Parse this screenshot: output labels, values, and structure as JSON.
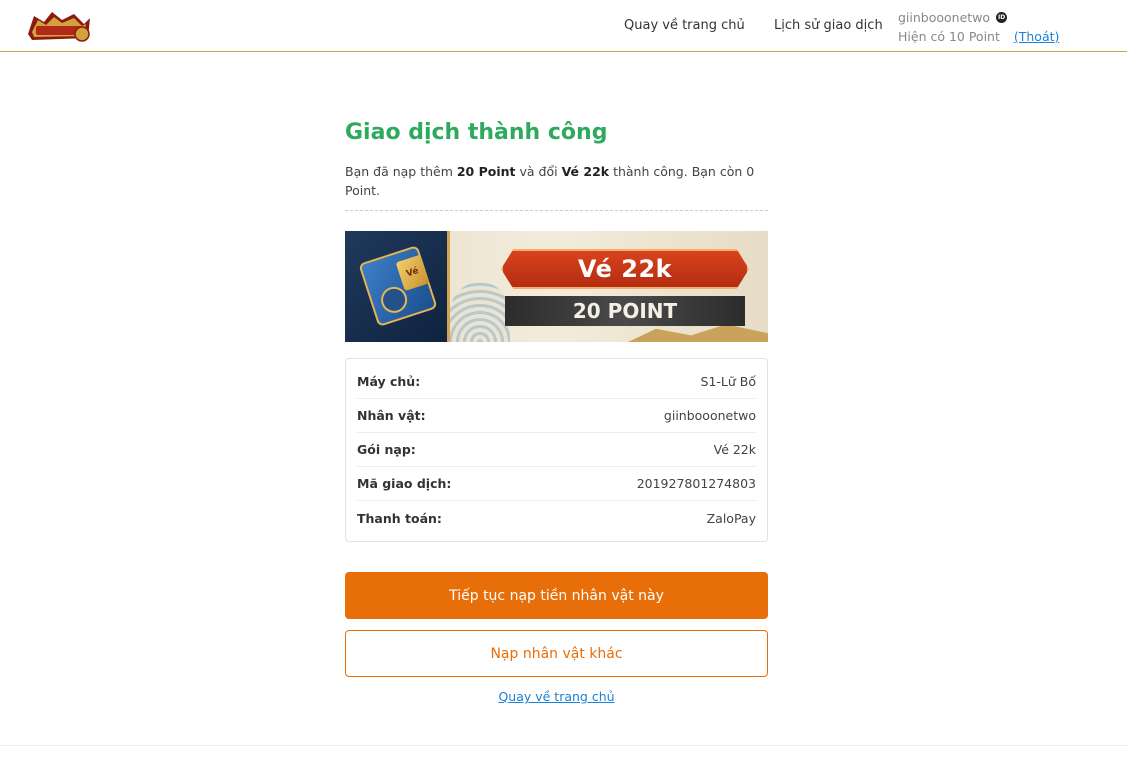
{
  "header": {
    "logo_icon": "game-logo",
    "nav": {
      "home": "Quay về trang chủ",
      "history": "Lịch sử giao dịch"
    },
    "user": {
      "username": "giinbooonetwo",
      "badge_icon": "id-icon",
      "points_text": "Hiện có 10 Point",
      "logout": "(Thoát)"
    }
  },
  "main": {
    "title": "Giao dịch thành công",
    "desc": {
      "p1": "Bạn đã nạp thêm ",
      "amount": "20 Point",
      "p2": " và đổi ",
      "item": "Vé 22k",
      "p3": " thành công. Bạn còn 0 Point."
    },
    "banner": {
      "ticket_tag": "Vé",
      "price": "Vé 22k",
      "points": "20 POINT"
    },
    "details": [
      {
        "label": "Máy chủ:",
        "value": "S1-Lữ Bố"
      },
      {
        "label": "Nhân vật:",
        "value": "giinbooonetwo"
      },
      {
        "label": "Gói nạp:",
        "value": "Vé 22k"
      },
      {
        "label": "Mã giao dịch:",
        "value": "201927801274803"
      },
      {
        "label": "Thanh toán:",
        "value": "ZaloPay"
      }
    ],
    "buttons": {
      "continue": "Tiếp tục nạp tiền nhân vật này",
      "other": "Nạp nhân vật khác",
      "back": "Quay về trang chủ"
    }
  },
  "colors": {
    "accent": "#e86e0a",
    "success": "#2eaa5e",
    "link": "#1a82d8",
    "header_border": "#c9a64a"
  }
}
